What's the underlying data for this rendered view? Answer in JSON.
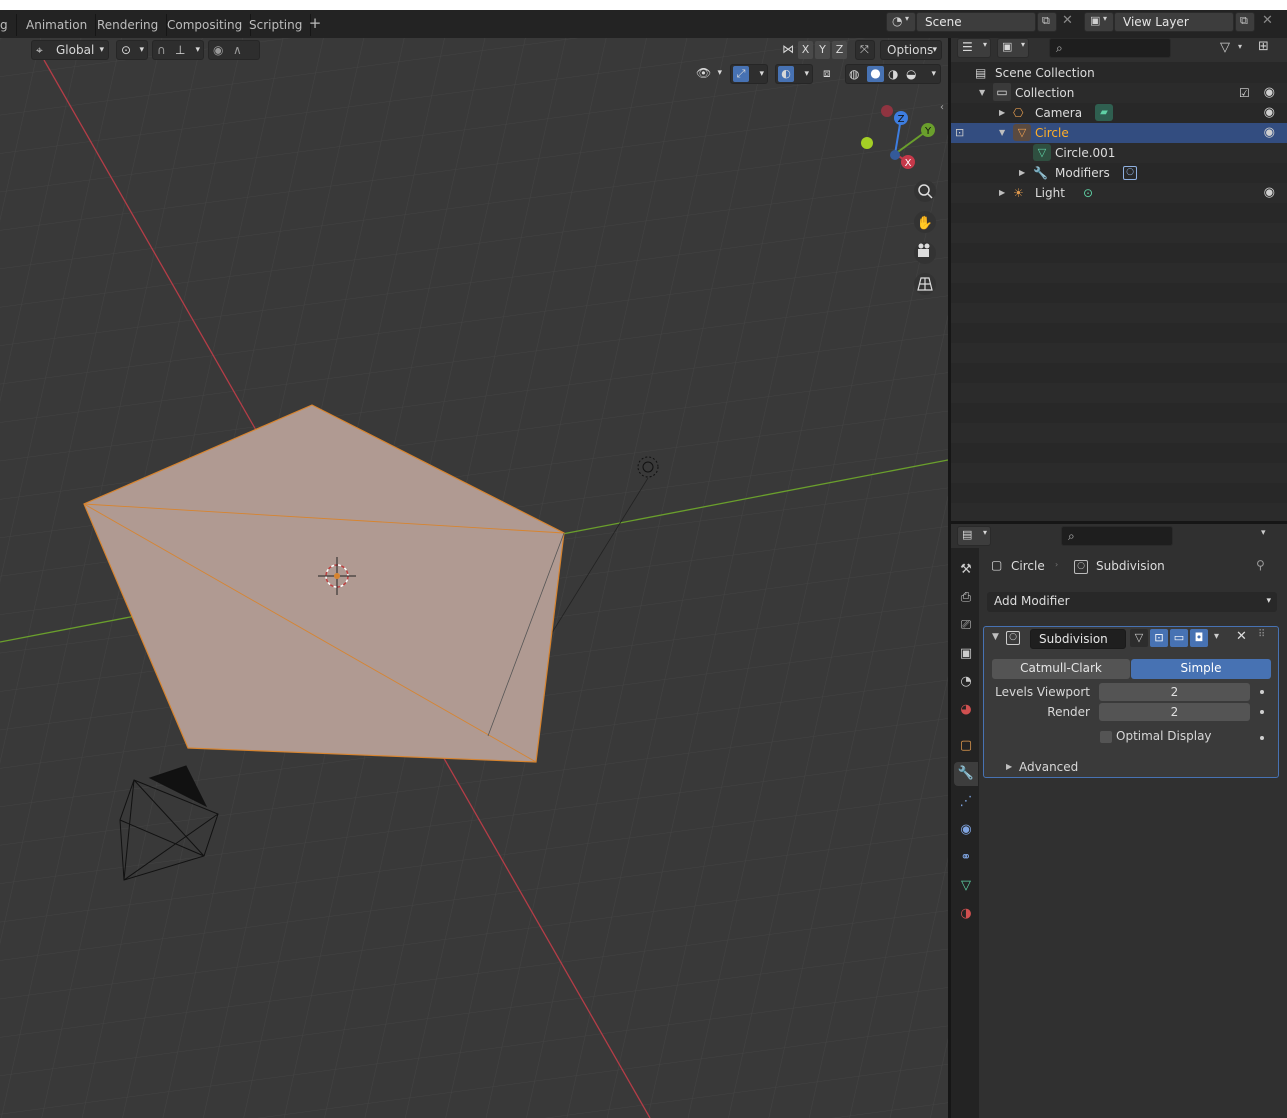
{
  "workspace_tabs": [
    "g",
    "Animation",
    "Rendering",
    "Compositing",
    "Scripting"
  ],
  "scene": {
    "label": "Scene"
  },
  "view_layer": {
    "label": "View Layer"
  },
  "viewport_header": {
    "orientation": "Global",
    "axis_x": "X",
    "axis_y": "Y",
    "axis_z": "Z",
    "options": "Options"
  },
  "gizmo": {
    "x": "X",
    "y": "Y",
    "z": "Z"
  },
  "outliner": {
    "rows": [
      {
        "label": "Scene Collection",
        "icon": "scene-collection-icon"
      },
      {
        "label": "Collection",
        "icon": "collection-icon"
      },
      {
        "label": "Camera",
        "icon": "camera-object-icon"
      },
      {
        "label": "Circle",
        "icon": "mesh-object-icon",
        "selected": true
      },
      {
        "label": "Circle.001",
        "icon": "mesh-data-icon"
      },
      {
        "label": "Modifiers",
        "icon": "wrench-icon"
      },
      {
        "label": "Light",
        "icon": "light-object-icon"
      }
    ]
  },
  "properties": {
    "breadcrumb_object": "Circle",
    "breadcrumb_modifier": "Subdivision",
    "add_modifier": "Add Modifier",
    "modifier": {
      "name": "Subdivision",
      "type_catmull": "Catmull-Clark",
      "type_simple": "Simple",
      "active_type": "Simple",
      "levels_viewport_label": "Levels Viewport",
      "levels_viewport": "2",
      "render_label": "Render",
      "render": "2",
      "optimal_display": "Optimal Display",
      "optimal_display_checked": false,
      "advanced": "Advanced"
    }
  },
  "colors": {
    "selection_blue": "#334d80",
    "accent_blue": "#4772b3",
    "mesh_fill": "#b09a92",
    "mesh_outline": "#d7842f",
    "x_axis": "#b43d47",
    "y_axis": "#6a9f2c"
  }
}
